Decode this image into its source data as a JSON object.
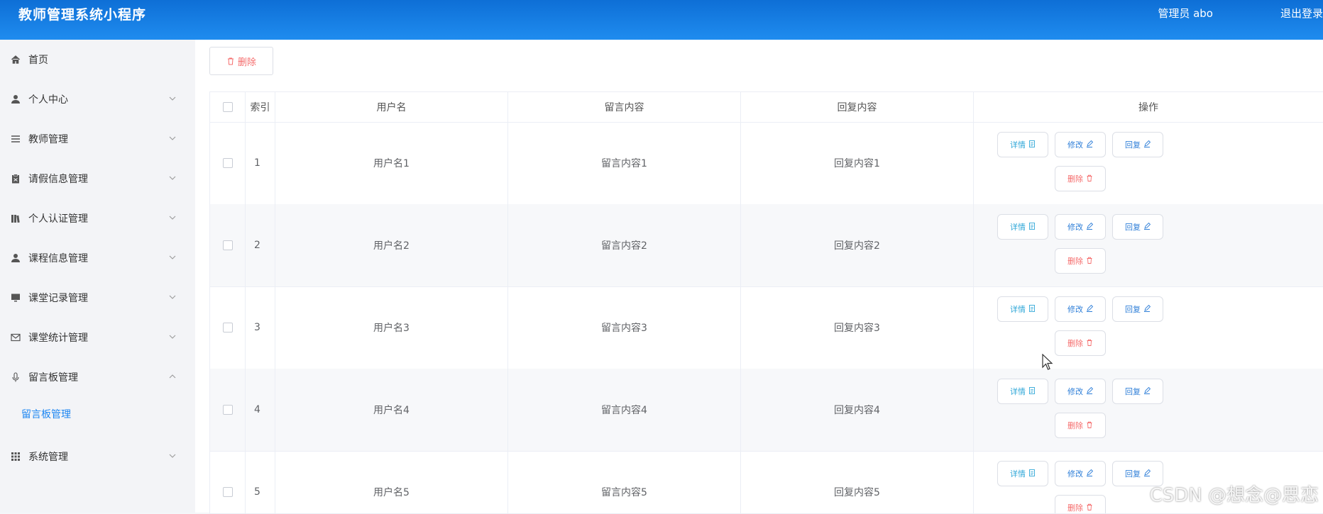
{
  "header": {
    "title": "教师管理系统小程序",
    "user": "管理员 abo",
    "logout": "退出登录",
    "bg": "#1a82e8"
  },
  "sidebar": {
    "items": [
      {
        "label": "首页",
        "icon": "home-icon",
        "expandable": false
      },
      {
        "label": "个人中心",
        "icon": "user-icon",
        "expandable": true
      },
      {
        "label": "教师管理",
        "icon": "list-icon",
        "expandable": true
      },
      {
        "label": "请假信息管理",
        "icon": "clipboard-icon",
        "expandable": true
      },
      {
        "label": "个人认证管理",
        "icon": "books-icon",
        "expandable": true
      },
      {
        "label": "课程信息管理",
        "icon": "user-icon",
        "expandable": true
      },
      {
        "label": "课堂记录管理",
        "icon": "monitor-icon",
        "expandable": true
      },
      {
        "label": "课堂统计管理",
        "icon": "mail-icon",
        "expandable": true
      },
      {
        "label": "留言板管理",
        "icon": "microphone-icon",
        "expandable": true,
        "expanded": true
      },
      {
        "label": "系统管理",
        "icon": "grid-icon",
        "expandable": true
      }
    ],
    "subitem": {
      "label": "留言板管理",
      "active": true,
      "color": "#1d86f2"
    }
  },
  "toolbar": {
    "delete_label": "删除"
  },
  "table": {
    "columns": [
      "",
      "索引",
      "用户名",
      "留言内容",
      "回复内容",
      "操作"
    ],
    "rows": [
      {
        "index": "1",
        "username": "用户名1",
        "message": "留言内容1",
        "reply": "回复内容1"
      },
      {
        "index": "2",
        "username": "用户名2",
        "message": "留言内容2",
        "reply": "回复内容2"
      },
      {
        "index": "3",
        "username": "用户名3",
        "message": "留言内容3",
        "reply": "回复内容3"
      },
      {
        "index": "4",
        "username": "用户名4",
        "message": "留言内容4",
        "reply": "回复内容4"
      },
      {
        "index": "5",
        "username": "用户名5",
        "message": "留言内容5",
        "reply": "回复内容5"
      }
    ],
    "actions": {
      "detail": "详情",
      "edit": "修改",
      "reply": "回复",
      "delete": "删除"
    }
  },
  "watermark": "CSDN @想念@思恋"
}
